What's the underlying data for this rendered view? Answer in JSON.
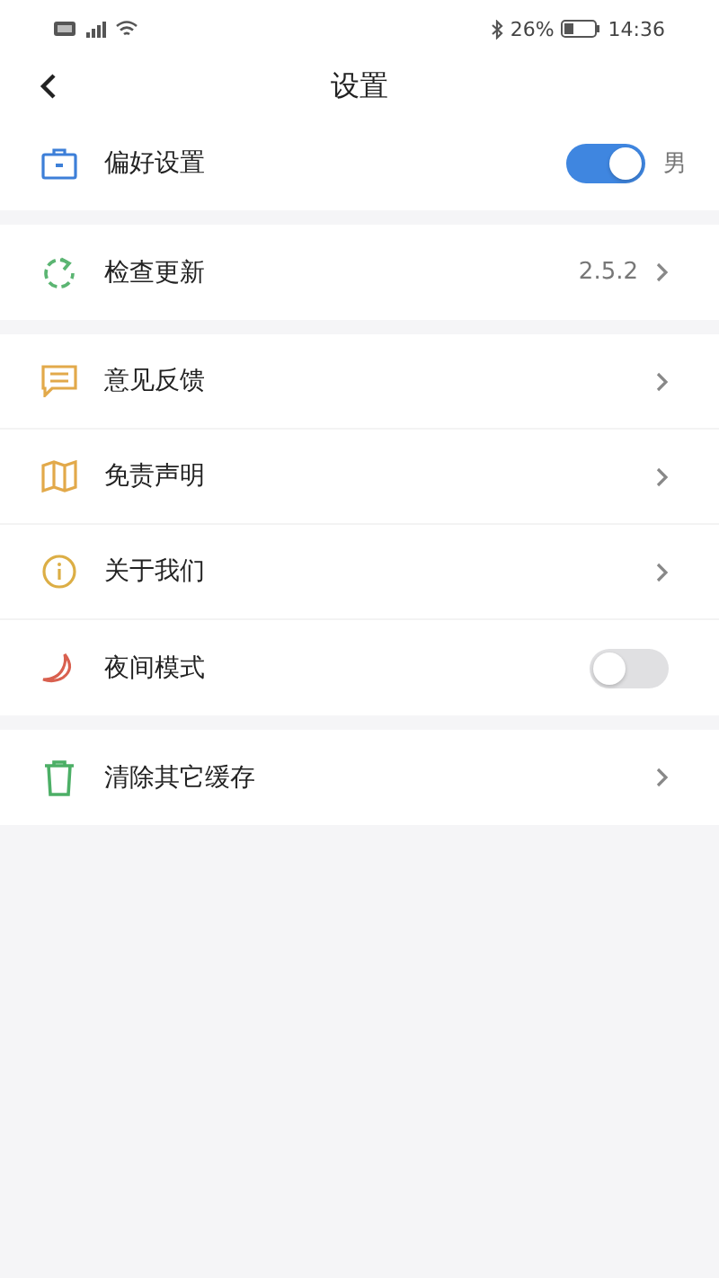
{
  "status_bar": {
    "battery": "26%",
    "time": "14:36"
  },
  "header": {
    "title": "设置"
  },
  "groups": [
    {
      "items": [
        {
          "label": "偏好设置",
          "kind": "switch",
          "on": true,
          "value": "男"
        }
      ]
    },
    {
      "items": [
        {
          "label": "检查更新",
          "kind": "link",
          "value": "2.5.2"
        }
      ]
    },
    {
      "items": [
        {
          "label": "意见反馈",
          "kind": "link"
        },
        {
          "label": "免责声明",
          "kind": "link"
        },
        {
          "label": "关于我们",
          "kind": "link"
        },
        {
          "label": "夜间模式",
          "kind": "switch",
          "on": false
        }
      ]
    },
    {
      "items": [
        {
          "label": "清除其它缓存",
          "kind": "link"
        }
      ]
    }
  ]
}
